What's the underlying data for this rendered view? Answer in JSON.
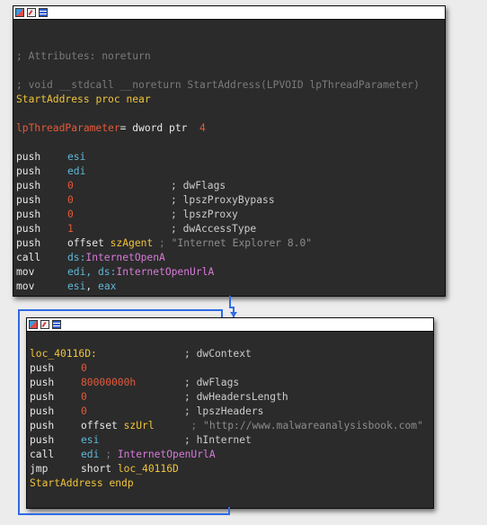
{
  "node1": {
    "lines": [
      {
        "type": "blank"
      },
      {
        "type": "blank"
      },
      {
        "type": "comment",
        "text": "; Attributes: noreturn"
      },
      {
        "type": "blank"
      },
      {
        "type": "comment",
        "text": "; void __stdcall __noreturn StartAddress(LPVOID lpThreadParameter)"
      },
      {
        "type": "proc",
        "name": "StartAddress",
        "kw": "proc near"
      },
      {
        "type": "blank"
      },
      {
        "type": "var",
        "name": "lpThreadParameter",
        "rest": "= dword ptr  ",
        "num": "4"
      },
      {
        "type": "blank"
      },
      {
        "type": "ins",
        "mn": "push",
        "op": "esi",
        "opc": "reg"
      },
      {
        "type": "ins",
        "mn": "push",
        "op": "edi",
        "opc": "reg"
      },
      {
        "type": "ins",
        "mn": "push",
        "op": "0",
        "opc": "num",
        "cm": "; dwFlags"
      },
      {
        "type": "ins",
        "mn": "push",
        "op": "0",
        "opc": "num",
        "cm": "; lpszProxyBypass"
      },
      {
        "type": "ins",
        "mn": "push",
        "op": "0",
        "opc": "num",
        "cm": "; lpszProxy"
      },
      {
        "type": "ins",
        "mn": "push",
        "op": "1",
        "opc": "num",
        "cm": "; dwAccessType"
      },
      {
        "type": "offs",
        "mn": "push",
        "op": "offset ",
        "name": "szAgent",
        "gap": " ; ",
        "str": "\"Internet Explorer 8.0\""
      },
      {
        "type": "api",
        "mn": "call",
        "pre": "ds:",
        "api": "InternetOpenA"
      },
      {
        "type": "mov",
        "mn": "mov",
        "reg": "edi",
        "mid": ", ds:",
        "api": "InternetOpenUrlA"
      },
      {
        "type": "mov2",
        "mn": "mov",
        "reg": "esi",
        "mid": ", ",
        "reg2": "eax"
      }
    ]
  },
  "node2": {
    "lines": [
      {
        "type": "blank"
      },
      {
        "type": "label",
        "name": "loc_40116D:",
        "cm": "; dwContext"
      },
      {
        "type": "ins",
        "mn": "push",
        "op": "0",
        "opc": "num"
      },
      {
        "type": "ins",
        "mn": "push",
        "op": "80000000h",
        "opc": "num",
        "cm": "; dwFlags"
      },
      {
        "type": "ins",
        "mn": "push",
        "op": "0",
        "opc": "num",
        "cm": "; dwHeadersLength"
      },
      {
        "type": "ins",
        "mn": "push",
        "op": "0",
        "opc": "num",
        "cm": "; lpszHeaders"
      },
      {
        "type": "offs",
        "mn": "push",
        "op": "offset ",
        "name": "szUrl",
        "gap": "      ; ",
        "str": "\"http://www.malwareanalysisbook.com\""
      },
      {
        "type": "ins",
        "mn": "push",
        "op": "esi",
        "opc": "reg",
        "cm": "; hInternet"
      },
      {
        "type": "callreg",
        "mn": "call",
        "reg": "edi",
        "gap": " ; ",
        "api": "InternetOpenUrlA"
      },
      {
        "type": "jmp",
        "mn": "jmp",
        "op": "short ",
        "name": "loc_40116D"
      },
      {
        "type": "endp",
        "name": "StartAddress",
        "kw": "endp"
      }
    ]
  },
  "colors": {
    "background": "#ececec",
    "node_bg": "#2b2b2b",
    "edge": "#2e6be6",
    "name": "#f0c43a",
    "number": "#e45a3a",
    "register": "#5fb8d8",
    "api": "#d87ad8",
    "comment": "#7a7a7a"
  }
}
